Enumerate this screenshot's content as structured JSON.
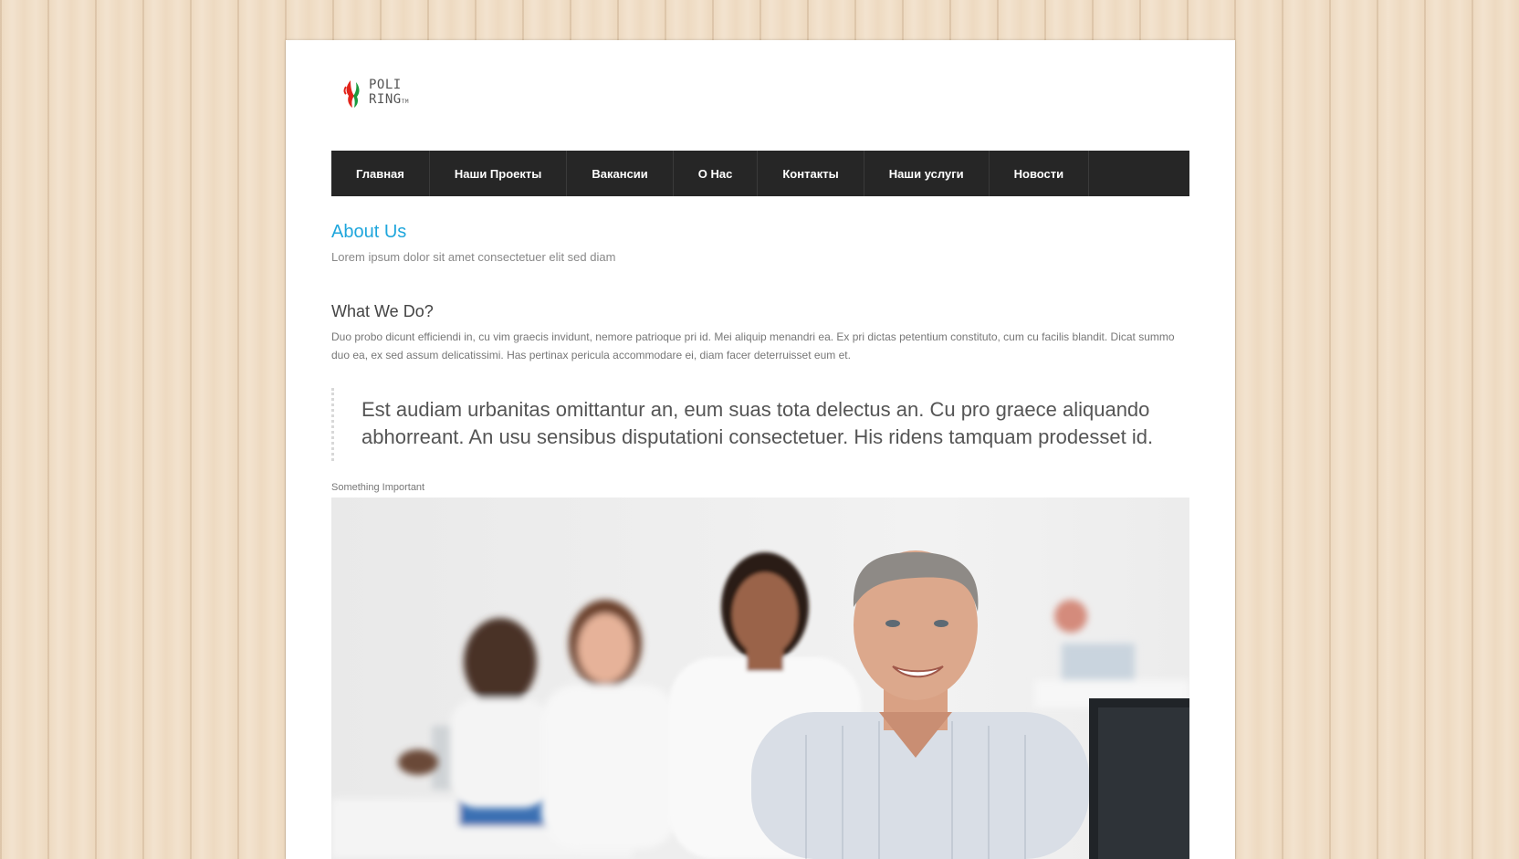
{
  "logo": {
    "line1": "POLI",
    "line2": "RING",
    "mark": "TM"
  },
  "nav": {
    "items": [
      "Главная",
      "Наши Проекты",
      "Вакансии",
      "О Нас",
      "Контакты",
      "Наши услуги",
      "Новости"
    ]
  },
  "header": {
    "title": "About Us",
    "subtitle": "Lorem ipsum dolor sit amet consectetuer elit sed diam"
  },
  "section": {
    "heading": "What We Do?",
    "paragraph": "Duo probo dicunt efficiendi in, cu vim graecis invidunt, nemore patrioque pri id. Mei aliquip menandri ea. Ex pri dictas petentium constituto, cum cu facilis blandit. Dicat summo duo ea, ex sed assum delicatissimi. Has pertinax pericula accommodare ei, diam facer deterruisset eum et.",
    "quote": "Est audiam urbanitas omittantur an, eum suas tota delectus an. Cu pro graece aliquando abhorreant. An usu sensibus disputationi consectetuer. His ridens tamquam prodesset id.",
    "caption": "Something Important"
  },
  "colors": {
    "accent": "#1fa6dc",
    "nav_bg": "#262626",
    "logo_red": "#e2231a",
    "logo_green": "#1a9a3e"
  }
}
